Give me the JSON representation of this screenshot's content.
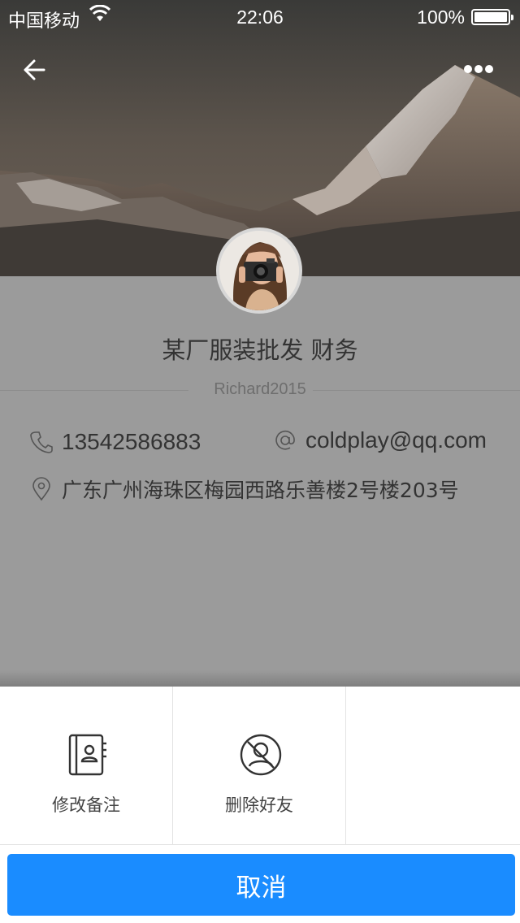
{
  "statusbar": {
    "carrier": "中国移动",
    "time": "22:06",
    "battery": "100%"
  },
  "profile": {
    "name": "某厂服装批发 财务",
    "username": "Richard2015",
    "phone": "13542586883",
    "email": "coldplay@qq.com",
    "address": "广东广州海珠区梅园西路乐善楼2号楼203号"
  },
  "actions": [
    {
      "label": "修改备注",
      "icon": "contact-book-icon"
    },
    {
      "label": "删除好友",
      "icon": "remove-friend-icon"
    }
  ],
  "cancel_label": "取消",
  "colors": {
    "accent": "#1a8cff",
    "overlay": "#9b9b9b",
    "text": "#333333"
  }
}
